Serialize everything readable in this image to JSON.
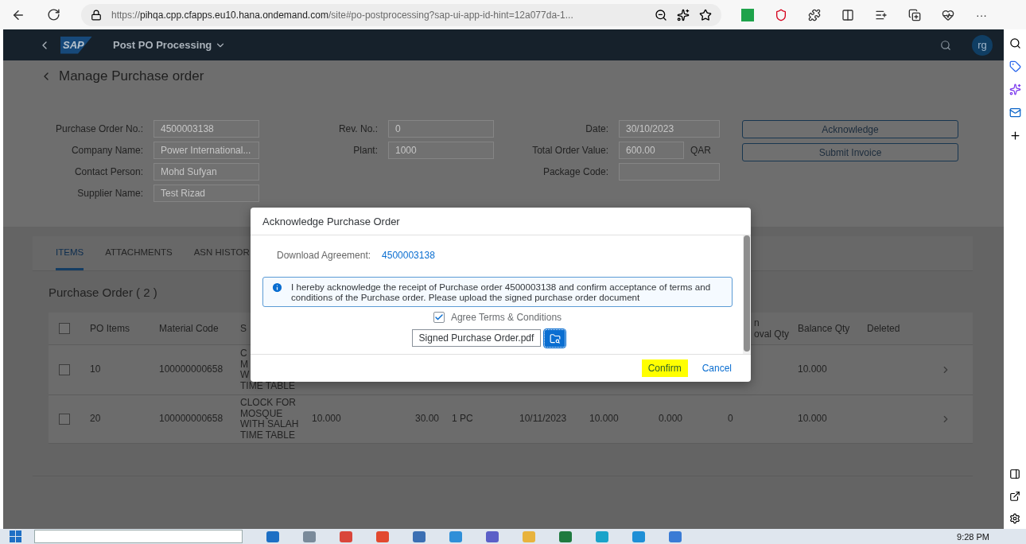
{
  "browser": {
    "scheme": "https://",
    "host": "pihqa.cpp.cfapps.eu10.hana.ondemand.com",
    "rest": "/site#po-postprocessing?sap-ui-app-id-hint=12a077da-1...",
    "more": "···"
  },
  "shell": {
    "logo": "SAP",
    "title": "Post PO Processing",
    "avatar": "rg"
  },
  "page": {
    "title": "Manage Purchase order"
  },
  "form": {
    "groups": [
      [
        {
          "label": "Purchase Order No.:",
          "value": "4500003138"
        },
        {
          "label": "Company Name:",
          "value": "Power International..."
        },
        {
          "label": "Contact Person:",
          "value": "Mohd Sufyan"
        },
        {
          "label": "Supplier Name:",
          "value": "Test Rizad"
        }
      ],
      [
        {
          "label": "Rev. No.:",
          "value": "0"
        },
        {
          "label": "Plant:",
          "value": "1000"
        }
      ],
      [
        {
          "label": "Date:",
          "value": "30/10/2023"
        },
        {
          "label": "Total Order Value:",
          "value": "600.00",
          "unit": "QAR"
        },
        {
          "label": "Package Code:"
        }
      ]
    ]
  },
  "actions": [
    "Acknowledge",
    "Submit Invoice"
  ],
  "tabs": [
    {
      "label": "ITEMS",
      "selected": true
    },
    {
      "label": "ATTACHMENTS",
      "selected": false
    },
    {
      "label": "ASN HISTOR",
      "selected": false
    }
  ],
  "table": {
    "title": "Purchase Order ( 2 )",
    "select_all": {
      "checked": false
    },
    "columns": [
      {
        "lines": [
          "PO Items"
        ]
      },
      {
        "lines": [
          "Material Code"
        ]
      },
      {
        "lines": [
          "S"
        ]
      },
      null,
      null,
      null,
      null,
      null,
      null,
      {
        "lines": [
          "n",
          "oval Qty"
        ]
      },
      {
        "lines": [
          "Balance Qty"
        ]
      },
      {
        "lines": [
          "Deleted"
        ]
      }
    ],
    "rows": [
      {
        "selected": false,
        "cells": [
          "10",
          "100000000658",
          [
            "C",
            "M",
            "W",
            "TIME TABLE"
          ],
          null,
          null,
          null,
          null,
          null,
          null,
          null,
          "10.000",
          null
        ]
      },
      {
        "selected": false,
        "cells": [
          "20",
          "100000000658",
          [
            "CLOCK FOR",
            "MOSQUE",
            "WITH SALAH",
            "TIME TABLE"
          ],
          "10.000",
          "30.00",
          "1 PC",
          "10/11/2023",
          "10.000",
          "0.000",
          "0",
          "10.000",
          null
        ]
      }
    ]
  },
  "dialog": {
    "title": "Acknowledge Purchase Order",
    "download_label": "Download Agreement:",
    "download_link": "4500003138",
    "info": "I hereby acknowledge the receipt of Purchase order 4500003138 and confirm acceptance of terms and conditions of the Purchase order. Please upload the signed purchase order document",
    "agree": {
      "label": "Agree Terms & Conditions",
      "checked": true
    },
    "file": {
      "value": "Signed Purchase Order.pdf"
    },
    "buttons": [
      {
        "label": "Confirm",
        "highlighted": true
      },
      {
        "label": "Cancel",
        "highlighted": false
      }
    ]
  },
  "taskbar": {
    "time": "9:28 PM"
  }
}
